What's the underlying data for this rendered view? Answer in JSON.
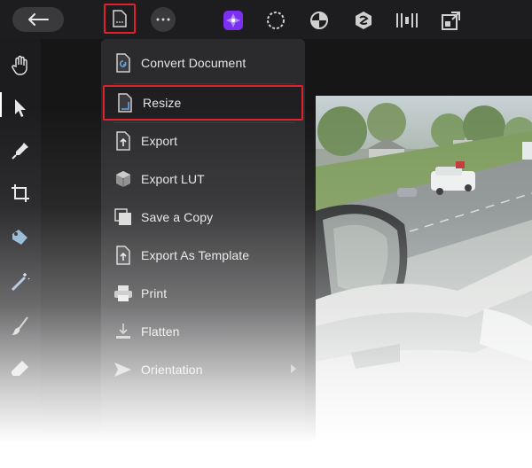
{
  "toolbar": {
    "back_icon": "arrow-left-icon",
    "document_icon": "document-icon",
    "more_icon": "ellipsis-icon",
    "personas": [
      "photo-persona-icon",
      "liquify-persona-icon",
      "develop-persona-icon",
      "tone-mapping-persona-icon",
      "export-persona-icon",
      "pixel-persona-icon"
    ],
    "accent_color": "#7b2ff0",
    "highlight_color": "#e0202a"
  },
  "tools": [
    "hand-icon",
    "move-icon",
    "color-picker-icon",
    "crop-icon",
    "selection-brush-icon",
    "flood-select-icon",
    "paint-brush-icon",
    "eraser-icon"
  ],
  "menu": {
    "items": [
      {
        "label": "Convert Document",
        "icon": "convert-document-icon"
      },
      {
        "label": "Resize",
        "icon": "resize-icon"
      },
      {
        "label": "Export",
        "icon": "export-icon"
      },
      {
        "label": "Export LUT",
        "icon": "export-lut-icon"
      },
      {
        "label": "Save a Copy",
        "icon": "save-copy-icon"
      },
      {
        "label": "Export As Template",
        "icon": "export-template-icon"
      },
      {
        "label": "Print",
        "icon": "print-icon"
      },
      {
        "label": "Flatten",
        "icon": "flatten-icon"
      },
      {
        "label": "Orientation",
        "icon": "orientation-icon"
      }
    ]
  }
}
